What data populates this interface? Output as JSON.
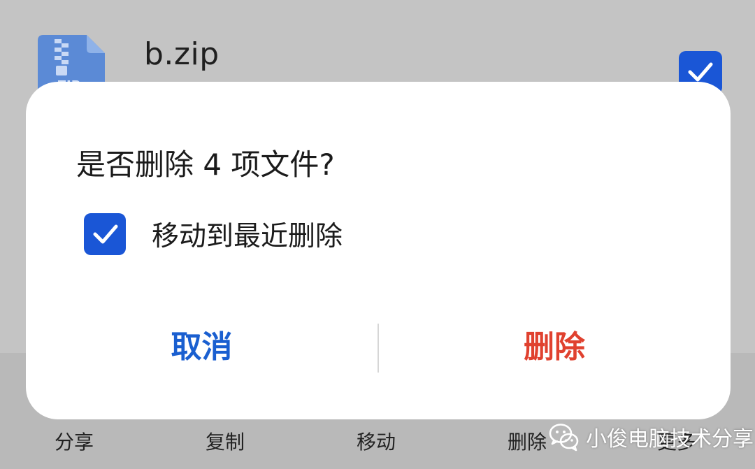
{
  "file_list": {
    "item": {
      "name": "b.zip",
      "icon": "zip-file-icon",
      "checked": true
    }
  },
  "bottom_bar": {
    "share": "分享",
    "copy": "复制",
    "move": "移动",
    "delete": "删除",
    "more": "更多"
  },
  "dialog": {
    "title": "是否删除 4 项文件?",
    "option_label": "移动到最近删除",
    "option_checked": true,
    "cancel_label": "取消",
    "delete_label": "删除"
  },
  "watermark": {
    "text": "小俊电脑技术分享",
    "icon": "wechat-logo-icon"
  },
  "colors": {
    "accent_blue": "#1a56d6",
    "cancel_blue": "#1a5fd0",
    "delete_red": "#e0412f",
    "scrim": "#c4c4c4",
    "dialog_bg": "#ffffff"
  }
}
